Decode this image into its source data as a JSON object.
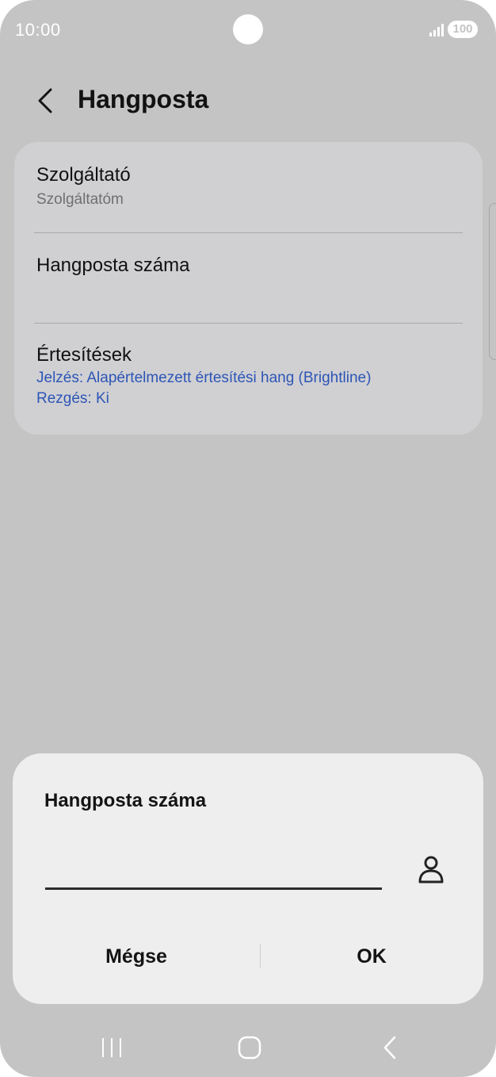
{
  "status_bar": {
    "time": "10:00",
    "battery": "100",
    "icons": [
      "signal-icon",
      "battery-badge"
    ]
  },
  "header": {
    "title": "Hangposta",
    "back_icon": "back-arrow-icon"
  },
  "settings": {
    "items": [
      {
        "title": "Szolgáltató",
        "subtitle": "Szolgáltatóm"
      },
      {
        "title": "Hangposta száma"
      },
      {
        "title": "Értesítések",
        "lines": [
          "Jelzés: Alapértelmezett értesítési hang (Brightline)",
          "Rezgés: Ki"
        ]
      }
    ]
  },
  "dialog": {
    "title": "Hangposta száma",
    "input_value": "",
    "input_placeholder": "",
    "contact_icon": "contact-icon",
    "cancel_label": "Mégse",
    "ok_label": "OK"
  },
  "colors": {
    "background": "#c4c4c4",
    "card": "#d0d0d3",
    "dialog": "#eeeeee",
    "link_blue": "#2d55b6",
    "text": "#111111"
  },
  "nav": {
    "icons": [
      "recents-icon",
      "home-icon",
      "back-icon"
    ]
  }
}
